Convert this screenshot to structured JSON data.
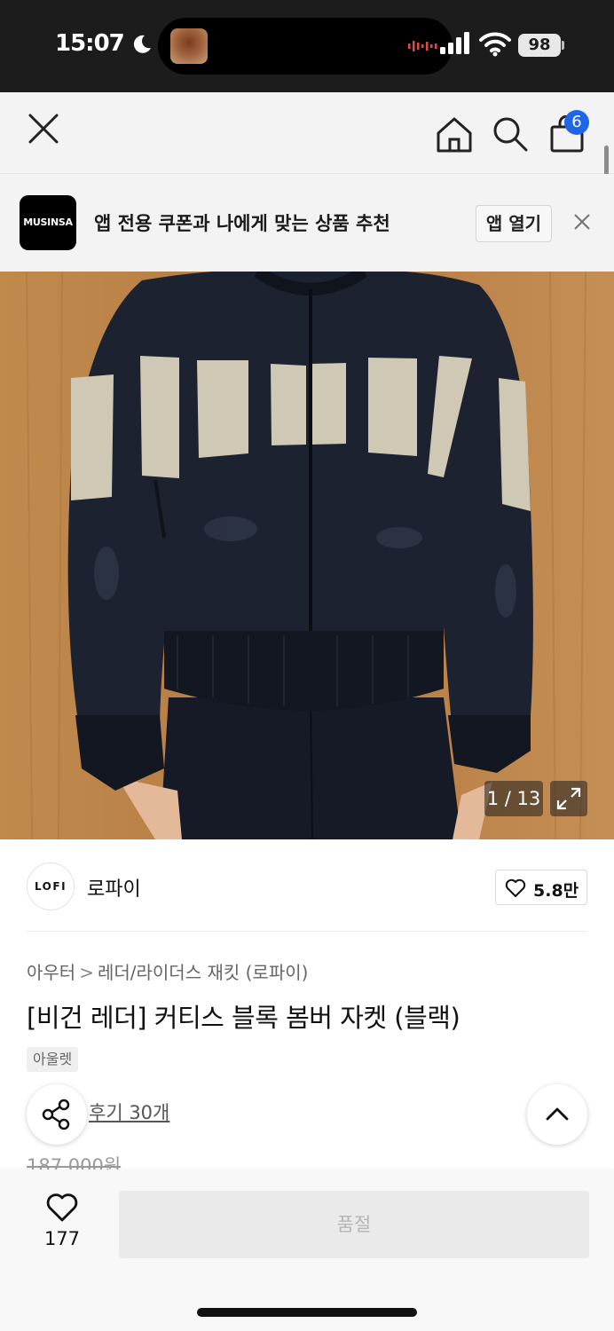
{
  "status_bar": {
    "time": "15:07",
    "battery": "98"
  },
  "nav": {
    "cart_count": "6",
    "icons": [
      "close-icon",
      "home-icon",
      "search-icon",
      "shopping-bag-icon"
    ]
  },
  "app_banner": {
    "logo_text": "MUSINSA",
    "message": "앱 전용 쿠폰과 나에게 맞는 상품 추천",
    "open_label": "앱 열기"
  },
  "gallery": {
    "counter": "1 / 13",
    "colors": {
      "wall": "#b77b42",
      "jacket": "#1c2230",
      "panel": "#cfc8b4"
    }
  },
  "brand": {
    "logo_text": "LOFI",
    "name": "로파이",
    "like_count": "5.8만"
  },
  "product": {
    "breadcrumb": [
      "아우터",
      "레더/라이더스 재킷 (로파이)"
    ],
    "title": "[비건 레더] 커티스 블록 봄버 자켓 (블랙)",
    "tag": "아울렛",
    "reviews": "후기 30개",
    "original_price": "187,000원"
  },
  "bottom_bar": {
    "wish_count": "177",
    "soldout_label": "품절"
  },
  "colors": {
    "accent": "#1e66e8",
    "status_bar_bg": "#1c1c1c"
  }
}
